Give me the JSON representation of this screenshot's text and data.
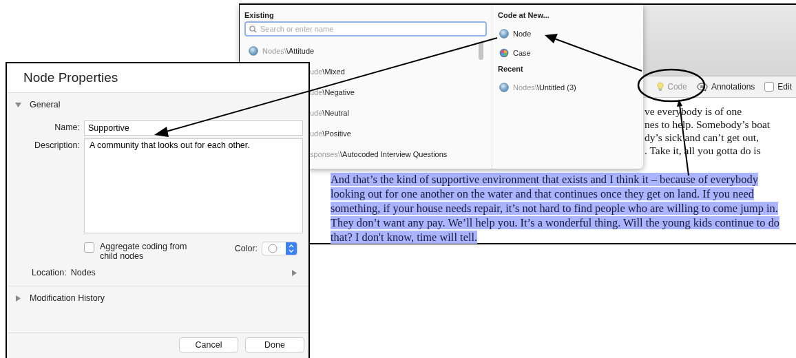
{
  "popup": {
    "existing_title": "Existing",
    "search": {
      "placeholder": "Search or enter name"
    },
    "items": [
      {
        "path": "Nodes\\",
        "name": "\\Attitude",
        "clipped": false
      },
      {
        "path": "ude",
        "name": "\\Mixed",
        "clipped": true
      },
      {
        "path": "ude",
        "name": "\\Negative",
        "clipped": true
      },
      {
        "path": "ude",
        "name": "\\Neutral",
        "clipped": true
      },
      {
        "path": "ude",
        "name": "\\Positive",
        "clipped": true
      },
      {
        "path": "sponses\\",
        "name": "\\Autocoded Interview Questions",
        "clipped": true
      }
    ],
    "new_title": "Code at New...",
    "new_items": [
      {
        "kind": "node",
        "label": "Node"
      },
      {
        "kind": "case",
        "label": "Case"
      }
    ],
    "recent_title": "Recent",
    "recent": [
      {
        "kind": "node",
        "path": "Nodes\\",
        "name": "\\Untitled (3)"
      }
    ]
  },
  "toolbar": [
    {
      "kind": "code",
      "label": "Code",
      "disabled": true
    },
    {
      "kind": "annotations",
      "label": "Annotations",
      "disabled": false
    },
    {
      "kind": "edit",
      "label": "Edit",
      "checked": false
    }
  ],
  "document": {
    "covered_lines": [
      "ve everybody is of one",
      "nes to help. Somebody’s boat",
      "dy’s sick and can’t get out,",
      ". Take it, all you gotta do is"
    ],
    "paragraph": "And that’s the kind of supportive environment that exists and I think it – because of everybody looking out for one another on the water and that continues once they get on land. If you need something, if your house needs repair, it’s not hard to find people who are willing to come jump in. They don’t want any pay. We’ll help you. It’s a wonderful thing. Will the young kids continue to do that? I don't know, time will tell.",
    "highlighted": true
  },
  "dialog": {
    "title": "Node Properties",
    "sections": [
      {
        "title": "General",
        "expanded": true
      },
      {
        "title": "Modification History",
        "expanded": false
      }
    ],
    "name_label": "Name:",
    "name": "Supportive",
    "description_label": "Description:",
    "description": "A community that looks out for each other.",
    "aggregate": {
      "label": "Aggregate coding from child nodes",
      "checked": false
    },
    "color_label": "Color:",
    "location_label": "Location:",
    "location": "Nodes",
    "buttons": [
      "Cancel",
      "Done"
    ]
  }
}
